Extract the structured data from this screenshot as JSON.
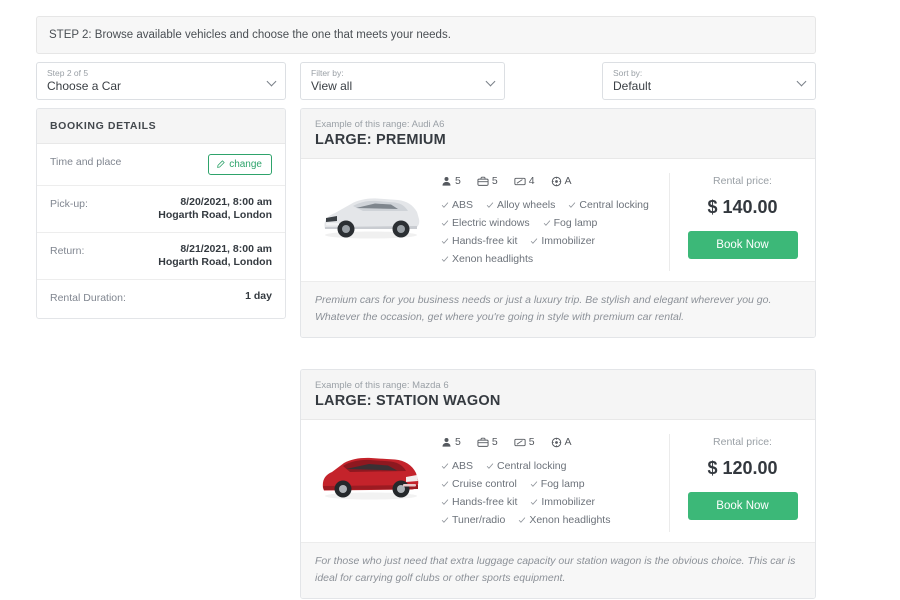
{
  "step_banner": {
    "text": "STEP 2: Browse available vehicles and choose the one that meets your needs."
  },
  "selectors": [
    {
      "label": "Step 2 of 5",
      "value": "Choose a Car"
    },
    {
      "label": "Filter by:",
      "value": "View all"
    },
    {
      "label": "Sort by:",
      "value": "Default"
    }
  ],
  "booking": {
    "title": "BOOKING DETAILS",
    "time_place_label": "Time and place",
    "change_label": "change",
    "pickup_label": "Pick-up:",
    "pickup_value_line1": "8/20/2021, 8:00 am",
    "pickup_value_line2": "Hogarth Road, London",
    "return_label": "Return:",
    "return_value_line1": "8/21/2021, 8:00 am",
    "return_value_line2": "Hogarth Road, London",
    "duration_label": "Rental Duration:",
    "duration_value": "1 day"
  },
  "price_label": "Rental price:",
  "book_label": "Book Now",
  "cars": [
    {
      "example_prefix": "Example of this range: ",
      "example_model": "Audi A6",
      "example": "Example of this range: Audi A6",
      "title": "LARGE: PREMIUM",
      "image_alt": "white-sedan-photo",
      "image_color": "#e9eaec",
      "specs": [
        {
          "icon": "passenger-icon",
          "value": "5"
        },
        {
          "icon": "luggage-icon",
          "value": "5"
        },
        {
          "icon": "door-icon",
          "value": "4"
        },
        {
          "icon": "transmission-icon",
          "value": "A"
        }
      ],
      "features": [
        "ABS",
        "Alloy wheels",
        "Central locking",
        "Electric windows",
        "Fog lamp",
        "Hands-free kit",
        "Immobilizer",
        "Xenon headlights"
      ],
      "price": "$ 140.00",
      "description": "Premium cars for you business needs or just a luxury trip. Be stylish and elegant wherever you go. Whatever the occasion, get where you're going in style with premium car rental."
    },
    {
      "example_prefix": "Example of this range: ",
      "example_model": "Mazda 6",
      "example": "Example of this range: Mazda 6",
      "title": "LARGE: STATION WAGON",
      "image_alt": "red-station-wagon-photo",
      "image_color": "#c4232b",
      "specs": [
        {
          "icon": "passenger-icon",
          "value": "5"
        },
        {
          "icon": "luggage-icon",
          "value": "5"
        },
        {
          "icon": "door-icon",
          "value": "5"
        },
        {
          "icon": "transmission-icon",
          "value": "A"
        }
      ],
      "features": [
        "ABS",
        "Central locking",
        "Cruise control",
        "Fog lamp",
        "Hands-free kit",
        "Immobilizer",
        "Tuner/radio",
        "Xenon headlights"
      ],
      "price": "$ 120.00",
      "description": "For those who just need that extra luggage capacity our station wagon is the obvious choice. This car is ideal for carrying golf clubs or other sports equipment."
    }
  ],
  "colors": {
    "accent_green": "#3cb878",
    "panel_grey": "#f5f5f5",
    "border": "#e3e5e8"
  }
}
